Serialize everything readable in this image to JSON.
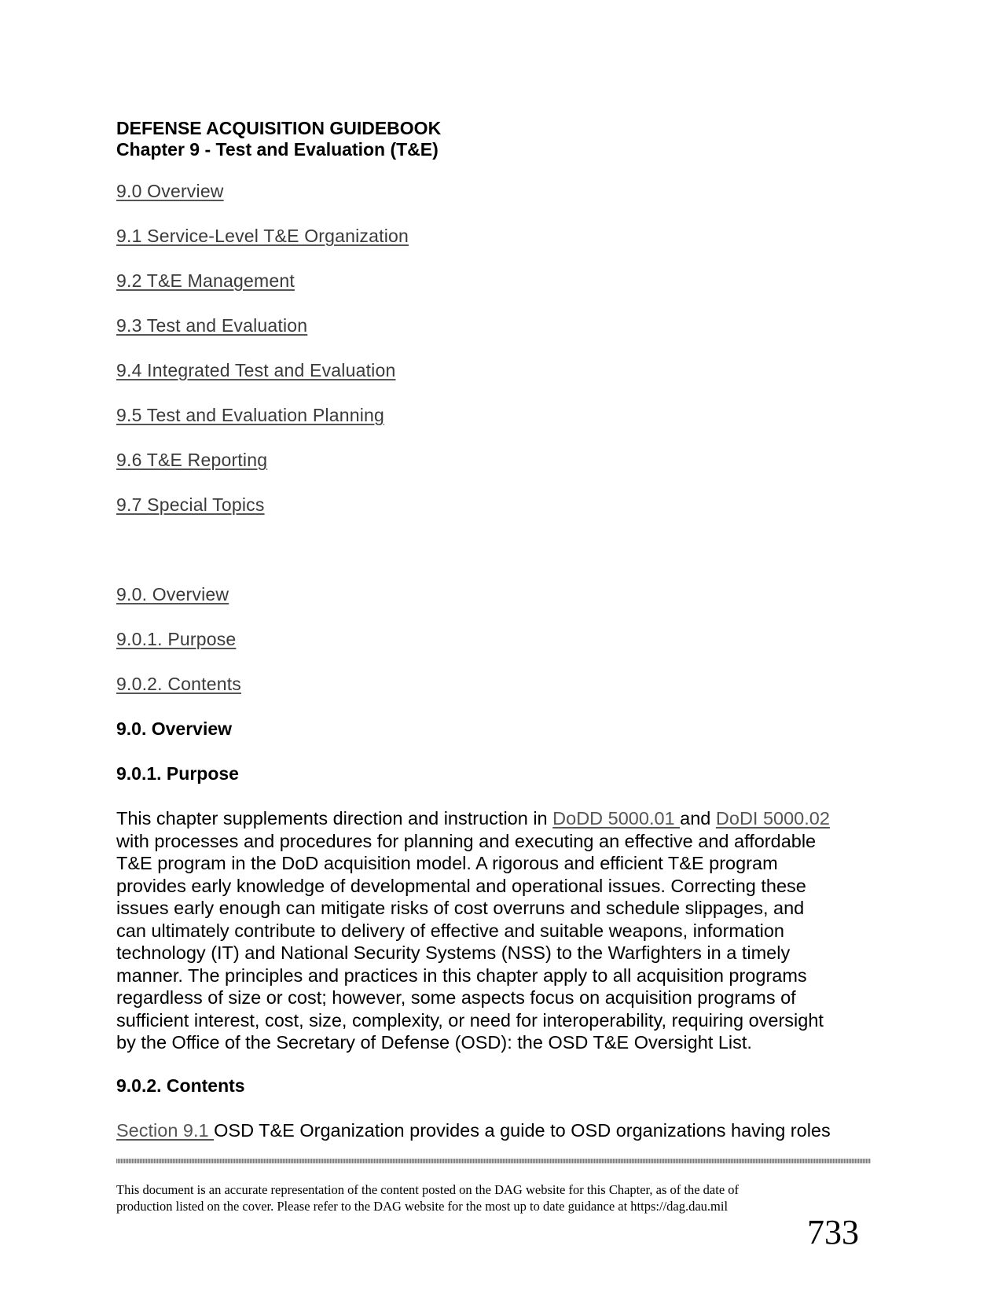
{
  "header": {
    "title": "DEFENSE ACQUISITION GUIDEBOOK",
    "subtitle": "Chapter 9 - Test and Evaluation (T&E)"
  },
  "toc": [
    {
      "label": "9.0 Overview"
    },
    {
      "label": "9.1 Service-Level T&E Organization"
    },
    {
      "label": "9.2 T&E Management"
    },
    {
      "label": "9.3 Test and Evaluation"
    },
    {
      "label": "9.4 Integrated Test and Evaluation"
    },
    {
      "label": "9.5 Test and Evaluation Planning"
    },
    {
      "label": "9.6 T&E Reporting"
    },
    {
      "label": "9.7 Special Topics"
    }
  ],
  "sub_toc": [
    {
      "label": "9.0. Overview"
    },
    {
      "label": "9.0.1. Purpose"
    },
    {
      "label": "9.0.2. Contents"
    }
  ],
  "sections": {
    "overview_heading": "9.0. Overview",
    "purpose_heading": "9.0.1. Purpose",
    "purpose_paragraph": {
      "line1_pre": "This chapter supplements direction and instruction in ",
      "link1": "DoDD 5000.01 ",
      "line1_mid": "and ",
      "link2": "DoDI 5000.02",
      "lines": [
        "with processes and procedures for planning and executing an effective and affordable",
        "T&E program in the DoD acquisition model. A rigorous and efficient T&E program",
        "provides early knowledge of developmental and operational issues. Correcting these",
        "issues early enough can mitigate risks of cost overruns and schedule slippages, and",
        "can ultimately contribute to delivery of effective and suitable weapons, information",
        "technology (IT) and National Security Systems (NSS) to the Warfighters in a timely",
        "manner. The principles and practices in this chapter apply to all acquisition programs",
        "regardless of size or cost; however, some aspects focus on acquisition programs of",
        "sufficient interest, cost, size, complexity, or need for interoperability, requiring oversight",
        "by the Office of the Secretary of Defense (OSD): the OSD T&E Oversight List."
      ]
    },
    "contents_heading": "9.0.2. Contents",
    "contents_line": {
      "link": "Section 9.1 ",
      "text": "OSD T&E Organization provides a guide to OSD organizations having roles"
    }
  },
  "footer": {
    "line1": "This document is an accurate representation of the content posted on the DAG website for this Chapter, as of the date of",
    "line2": "production listed on the cover. Please refer to the DAG website for the most up to date guidance at https://dag.dau.mil",
    "page_number": "733"
  }
}
